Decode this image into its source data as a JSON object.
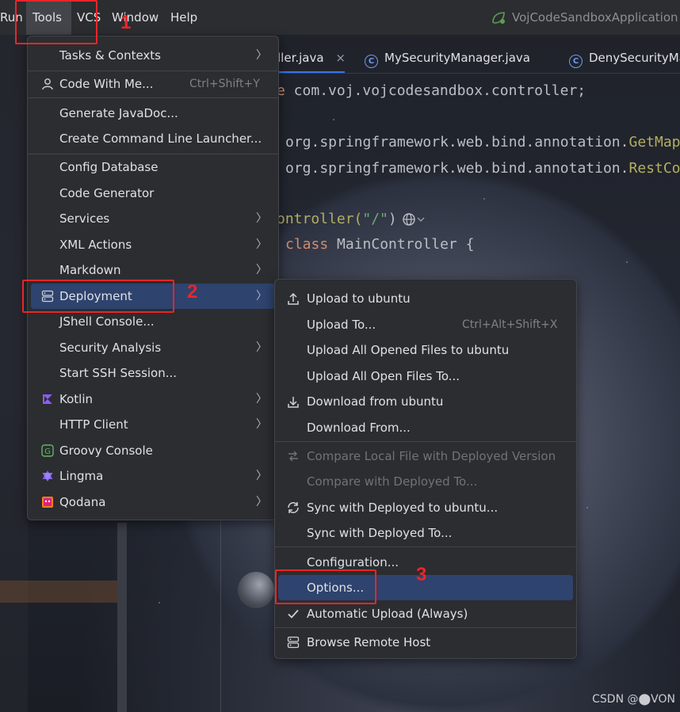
{
  "menubar": {
    "items": [
      "Run",
      "Tools",
      "VCS",
      "Window",
      "Help"
    ],
    "app_title": "VojCodeSandboxApplication"
  },
  "tabs": [
    {
      "label": "ller.java",
      "close": "×"
    },
    {
      "label": "MySecurityManager.java"
    },
    {
      "label": "DenySecurityMa"
    }
  ],
  "code_lines": [
    {
      "a": "e",
      "b": " com.voj.vojcodesandbox.controller;"
    },
    {
      "a": "",
      "b": "org.springframework.web.bind.annotation.",
      "c": "GetMap"
    },
    {
      "a": "",
      "b": "org.springframework.web.bind.annotation.",
      "c": "RestCo"
    },
    {
      "a": "ontroller(",
      "s": "\"/\"",
      "b": ")"
    },
    {
      "k": "class",
      "b": " MainController {"
    }
  ],
  "tools_menu": {
    "items": [
      {
        "label": "Tasks & Contexts",
        "submenu": true,
        "icon": ""
      },
      {
        "label": "Code With Me...",
        "shortcut": "Ctrl+Shift+Y",
        "icon": "person-icon"
      },
      {
        "label": "Generate JavaDoc...",
        "icon": ""
      },
      {
        "label": "Create Command Line Launcher...",
        "icon": ""
      },
      {
        "label": "Config Database",
        "icon": ""
      },
      {
        "label": "Code Generator",
        "icon": ""
      },
      {
        "label": "Services",
        "submenu": true,
        "icon": ""
      },
      {
        "label": "XML Actions",
        "submenu": true,
        "icon": ""
      },
      {
        "label": "Markdown",
        "submenu": true,
        "icon": ""
      },
      {
        "label": "Deployment",
        "submenu": true,
        "icon": "server-icon",
        "selected": true
      },
      {
        "label": "JShell Console...",
        "icon": ""
      },
      {
        "label": "Security Analysis",
        "submenu": true,
        "icon": ""
      },
      {
        "label": "Start SSH Session...",
        "icon": ""
      },
      {
        "label": "Kotlin",
        "submenu": true,
        "icon": "kotlin-icon"
      },
      {
        "label": "HTTP Client",
        "submenu": true,
        "icon": ""
      },
      {
        "label": "Groovy Console",
        "icon": "groovy-icon"
      },
      {
        "label": "Lingma",
        "submenu": true,
        "icon": "lingma-icon"
      },
      {
        "label": "Qodana",
        "submenu": true,
        "icon": "qodana-icon"
      }
    ]
  },
  "deployment_menu": {
    "items": [
      {
        "label": "Upload to ubuntu",
        "icon": "upload-icon"
      },
      {
        "label": "Upload To...",
        "shortcut": "Ctrl+Alt+Shift+X"
      },
      {
        "label": "Upload All Opened Files to ubuntu"
      },
      {
        "label": "Upload All Open Files To..."
      },
      {
        "label": "Download from ubuntu",
        "icon": "download-icon"
      },
      {
        "label": "Download From..."
      },
      {
        "label": "Compare Local File with Deployed Version",
        "disabled": true,
        "icon": "compare-icon"
      },
      {
        "label": "Compare with Deployed To...",
        "disabled": true
      },
      {
        "label": "Sync with Deployed to ubuntu...",
        "icon": "sync-icon"
      },
      {
        "label": "Sync with Deployed To..."
      },
      {
        "label": "Configuration..."
      },
      {
        "label": "Options...",
        "selected": true
      },
      {
        "label": "Automatic Upload (Always)",
        "icon": "checkmark-icon"
      },
      {
        "label": "Browse Remote Host",
        "icon": "server-icon"
      }
    ]
  },
  "annotations": [
    "1",
    "2",
    "3"
  ],
  "watermark": "CSDN @⬤VON",
  "colors": {
    "selection": "#2e436e",
    "annotation_red": "#e8262b",
    "menu_bg": "#2b2d30",
    "accent_blue": "#3574f0"
  }
}
